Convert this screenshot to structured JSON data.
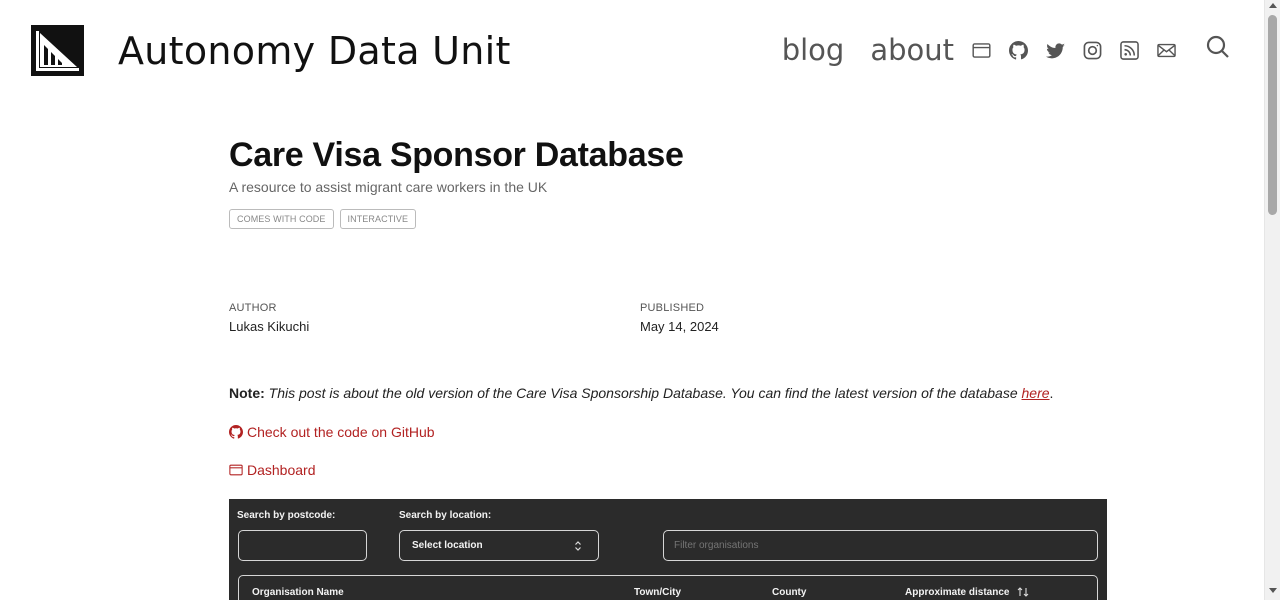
{
  "header": {
    "site_title": "Autonomy Data Unit",
    "nav": {
      "blog": "blog",
      "about": "about"
    },
    "icons": [
      "window-icon",
      "github-icon",
      "twitter-icon",
      "instagram-icon",
      "rss-icon",
      "mail-icon",
      "search-icon"
    ]
  },
  "post": {
    "title": "Care Visa Sponsor Database",
    "subtitle": "A resource to assist migrant care workers in the UK",
    "tags": [
      "COMES WITH CODE",
      "INTERACTIVE"
    ],
    "author_label": "AUTHOR",
    "author": "Lukas Kikuchi",
    "published_label": "PUBLISHED",
    "published": "May 14, 2024"
  },
  "note": {
    "label": "Note:",
    "text": "This post is about the old version of the Care Visa Sponsorship Database. You can find the latest version of the database",
    "link": "here",
    "end": "."
  },
  "links": {
    "github": "Check out the code on GitHub",
    "dashboard": "Dashboard"
  },
  "dashboard": {
    "postcode_label": "Search by postcode:",
    "postcode_value": "",
    "location_label": "Search by location:",
    "location_selected": "Select location",
    "filter_placeholder": "Filter organisations",
    "columns": [
      "Organisation Name",
      "Town/City",
      "County",
      "Approximate distance"
    ]
  },
  "colors": {
    "accent": "#b22222",
    "dashboard_bg": "#2b2b2b",
    "text": "#111111"
  }
}
